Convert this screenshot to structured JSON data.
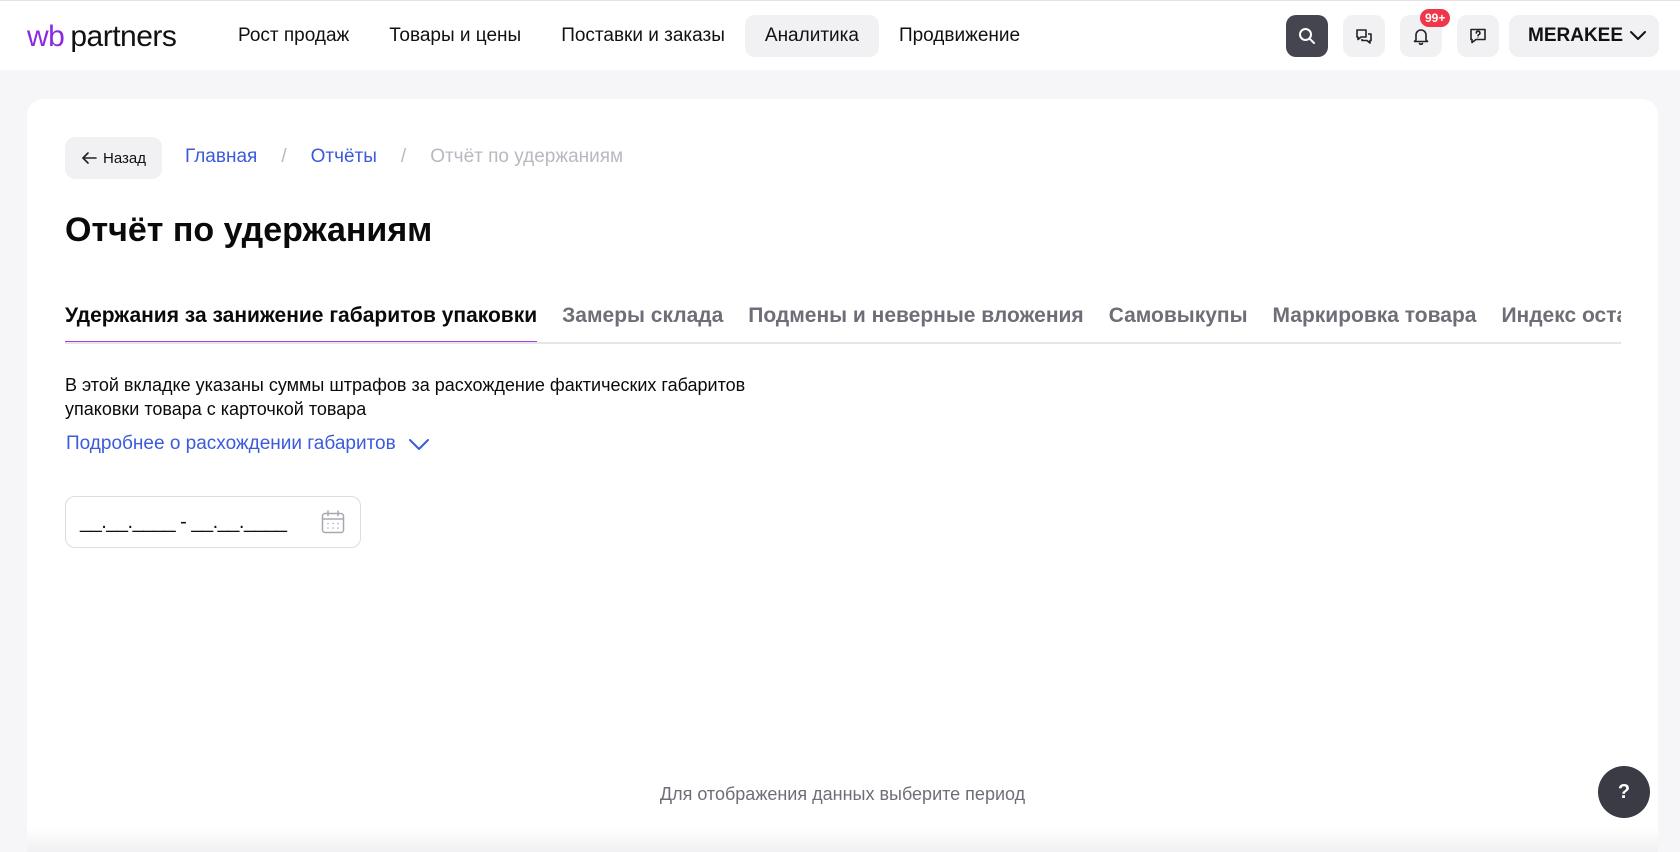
{
  "header": {
    "logo_wb": "wb",
    "logo_partners": "partners",
    "nav": [
      {
        "label": "Рост продаж"
      },
      {
        "label": "Товары и цены"
      },
      {
        "label": "Поставки и заказы"
      },
      {
        "label": "Аналитика"
      },
      {
        "label": "Продвижение"
      }
    ],
    "notifications_badge": "99+",
    "account_name": "MERAKEE",
    "icons": {
      "search": "search-icon",
      "chat": "chat-icon",
      "notifications": "bell-icon",
      "support": "support-chat-icon",
      "account_menu": "chevron-down-icon"
    }
  },
  "page": {
    "back_label": "Назад",
    "breadcrumb": [
      {
        "label": "Главная"
      },
      {
        "label": "Отчёты"
      },
      {
        "label": "Отчёт по удержаниям"
      }
    ],
    "breadcrumb_separator": "/",
    "title": "Отчёт по удержаниям",
    "tabs": [
      {
        "label": "Удержания за занижение габаритов упаковки",
        "active": true
      },
      {
        "label": "Замеры склада"
      },
      {
        "label": "Подмены и неверные вложения"
      },
      {
        "label": "Самовыкупы"
      },
      {
        "label": "Маркировка товара"
      },
      {
        "label": "Индекс остат"
      }
    ],
    "description_line1": "В этой вкладке указаны суммы штрафов за расхождение фактических габаритов",
    "description_line2": "упаковки товара с карточкой товара",
    "more_link": "Подробнее о расхождении габаритов",
    "date_range_value": "__.__.____ - __.__.____",
    "empty_message": "Для отображения данных выберите период",
    "help_label": "?"
  },
  "colors": {
    "accent_purple": "#a43fe0",
    "link_blue": "#3b5bdb",
    "badge_red": "#f0374a",
    "dark_button": "#44454f"
  }
}
